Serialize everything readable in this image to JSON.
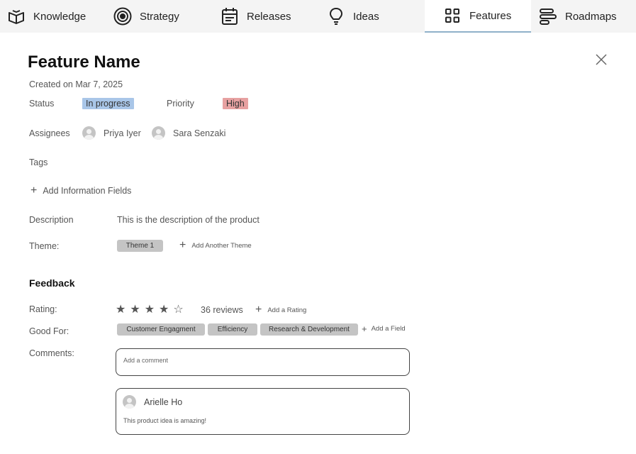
{
  "nav": {
    "tabs": [
      {
        "label": "Knowledge",
        "icon": "book-open-icon"
      },
      {
        "label": "Strategy",
        "icon": "target-icon"
      },
      {
        "label": "Releases",
        "icon": "calendar-icon"
      },
      {
        "label": "Ideas",
        "icon": "lightbulb-icon"
      },
      {
        "label": "Features",
        "icon": "grid-icon",
        "active": true
      },
      {
        "label": "Roadmaps",
        "icon": "roadmap-icon"
      }
    ]
  },
  "feature": {
    "title": "Feature Name",
    "created": "Created on Mar 7, 2025",
    "status_label": "Status",
    "status_value": "In progress",
    "priority_label": "Priority",
    "priority_value": "High",
    "assignees_label": "Assignees",
    "assignees": [
      "Priya Iyer",
      "Sara Senzaki"
    ],
    "tags_label": "Tags",
    "add_info_fields": "Add Information Fields",
    "description_label": "Description",
    "description_value": "This is the description of the product",
    "theme_label": "Theme:",
    "theme_chip": "Theme 1",
    "add_theme": "Add Another Theme"
  },
  "feedback": {
    "heading": "Feedback",
    "rating_label": "Rating:",
    "rating_value": 4,
    "rating_max": 5,
    "reviews": "36 reviews",
    "add_rating": "Add a Rating",
    "good_for_label": "Good For:",
    "good_for": [
      "Customer Engagment",
      "Efficiency",
      "Research & Development"
    ],
    "add_field": "Add a Field",
    "comments_label": "Comments:",
    "comment_placeholder": "Add a comment",
    "comments": [
      {
        "author": "Arielle Ho",
        "text": "This product idea is amazing!"
      }
    ]
  },
  "colors": {
    "status_in_progress": "#a9c6e8",
    "priority_high": "#e7a1a1",
    "active_tab_underline": "#8fb0c9",
    "chip": "#c4c4c4"
  }
}
